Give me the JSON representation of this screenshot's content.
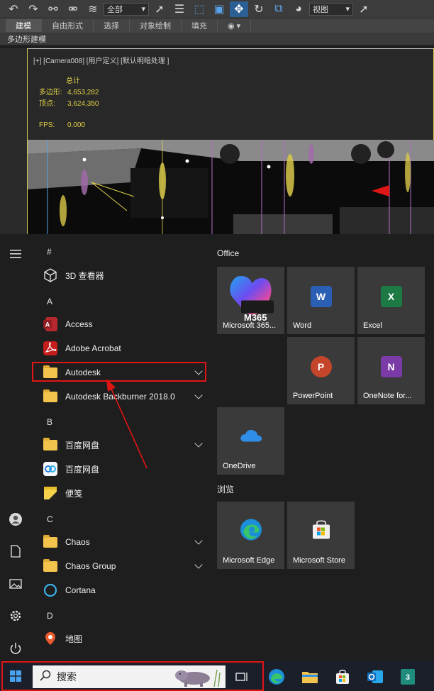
{
  "max": {
    "toolbar": {
      "filter_select": "全部",
      "view_select": "视图"
    },
    "ribbon_tabs": [
      "建模",
      "自由形式",
      "选择",
      "对象绘制",
      "填充"
    ],
    "active_ribbon_tab": "建模",
    "subribbon_label": "多边形建模",
    "viewport": {
      "label": "[+] [Camera008] [用户定义] [默认明暗处理 ]",
      "stats_header": "总计",
      "polys_label": "多边形:",
      "polys_value": "4,653,282",
      "verts_label": "顶点:",
      "verts_value": "3,624,350",
      "fps_label": "FPS:",
      "fps_value": "0.000"
    }
  },
  "start_menu": {
    "rail_icons": [
      "hamburger-icon",
      "user-icon",
      "document-icon",
      "pictures-icon",
      "settings-icon",
      "power-icon"
    ],
    "sections": [
      {
        "letter": "#",
        "apps": [
          {
            "label": "3D 查看器",
            "icon": "cube-icon",
            "folder": false
          }
        ]
      },
      {
        "letter": "A",
        "apps": [
          {
            "label": "Access",
            "icon": "access-icon",
            "folder": false
          },
          {
            "label": "Adobe Acrobat",
            "icon": "acrobat-icon",
            "folder": false
          },
          {
            "label": "Autodesk",
            "icon": "folder-icon",
            "folder": true
          },
          {
            "label": "Autodesk Backburner 2018.0",
            "icon": "folder-icon",
            "folder": true
          }
        ]
      },
      {
        "letter": "B",
        "apps": [
          {
            "label": "百度网盘",
            "icon": "folder-icon",
            "folder": true
          },
          {
            "label": "百度网盘",
            "icon": "baidu-netdisk-icon",
            "folder": false
          },
          {
            "label": "便笺",
            "icon": "sticky-notes-icon",
            "folder": false
          }
        ]
      },
      {
        "letter": "C",
        "apps": [
          {
            "label": "Chaos",
            "icon": "folder-icon",
            "folder": true
          },
          {
            "label": "Chaos Group",
            "icon": "folder-icon",
            "folder": true
          },
          {
            "label": "Cortana",
            "icon": "cortana-icon",
            "folder": false
          }
        ]
      },
      {
        "letter": "D",
        "apps": [
          {
            "label": "地图",
            "icon": "maps-icon",
            "folder": false
          }
        ]
      }
    ],
    "tile_groups": [
      {
        "title": "Office",
        "tiles": [
          {
            "label": "Microsoft 365...",
            "icon": "m365-icon",
            "badge": "M365"
          },
          {
            "label": "Word",
            "icon": "word-icon",
            "letter": "W",
            "color": "#2b5fb4"
          },
          {
            "label": "Excel",
            "icon": "excel-icon",
            "letter": "X",
            "color": "#1d7a45"
          },
          {
            "label": "PowerPoint",
            "icon": "powerpoint-icon",
            "letter": "P",
            "color": "#c4452a"
          },
          {
            "label": "OneNote for...",
            "icon": "onenote-icon",
            "letter": "N",
            "color": "#7a3aa8"
          },
          {
            "label": "OneDrive",
            "icon": "onedrive-icon"
          }
        ]
      },
      {
        "title": "浏览",
        "tiles": [
          {
            "label": "Microsoft Edge",
            "icon": "edge-icon"
          },
          {
            "label": "Microsoft Store",
            "icon": "store-icon"
          }
        ]
      }
    ]
  },
  "taskbar": {
    "search_placeholder": "搜索",
    "pinned": [
      "task-view-icon",
      "edge-icon",
      "file-explorer-icon",
      "store-icon",
      "outlook-icon",
      "3dsmax-icon"
    ]
  },
  "colors": {
    "highlight_red": "#e01515",
    "stats_yellow": "#e0d048"
  }
}
